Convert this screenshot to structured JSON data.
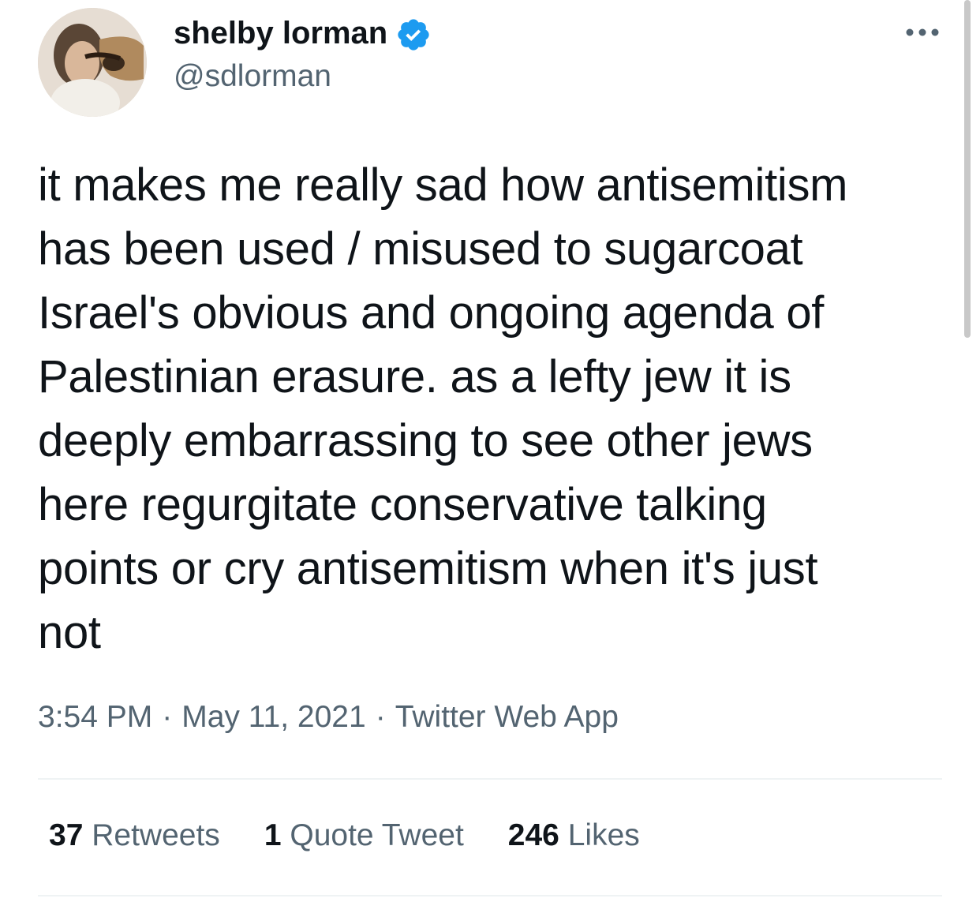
{
  "tweet": {
    "author": {
      "display_name": "shelby lorman",
      "handle": "@sdlorman",
      "verified": true
    },
    "text": "it makes me really sad how antisemitism\nhas been used / misused to sugarcoat\nIsrael's obvious and ongoing agenda of\nPalestinian erasure. as a lefty jew it is\ndeeply embarrassing to see other jews\nhere regurgitate conservative talking\npoints or cry antisemitism when it's just\nnot",
    "time": "3:54 PM",
    "separator": "·",
    "date": "May 11, 2021",
    "source": "Twitter Web App",
    "stats": {
      "retweets_count": "37",
      "retweets_label": "Retweets",
      "quotes_count": "1",
      "quotes_label": "Quote Tweet",
      "likes_count": "246",
      "likes_label": "Likes"
    }
  },
  "icons": {
    "verified": "verified-badge-icon",
    "more": "more-options-icon"
  },
  "colors": {
    "text_primary": "#0f1419",
    "text_secondary": "#536471",
    "verified_blue": "#1d9bf0",
    "divider": "#eff3f4"
  }
}
